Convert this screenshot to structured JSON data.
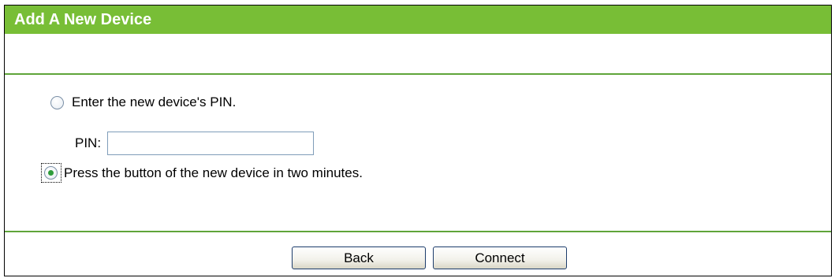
{
  "dialog": {
    "title": "Add A New Device"
  },
  "options": {
    "pin": {
      "label": "Enter the new device's PIN.",
      "selected": false
    },
    "pin_field": {
      "label": "PIN:",
      "value": ""
    },
    "pbc": {
      "label": "Press the button of the new device in two minutes.",
      "selected": true
    }
  },
  "buttons": {
    "back": "Back",
    "connect": "Connect"
  },
  "colors": {
    "header_green": "#78be36",
    "divider_green": "#5fa53a",
    "radio_dot": "#2e9c3a"
  }
}
